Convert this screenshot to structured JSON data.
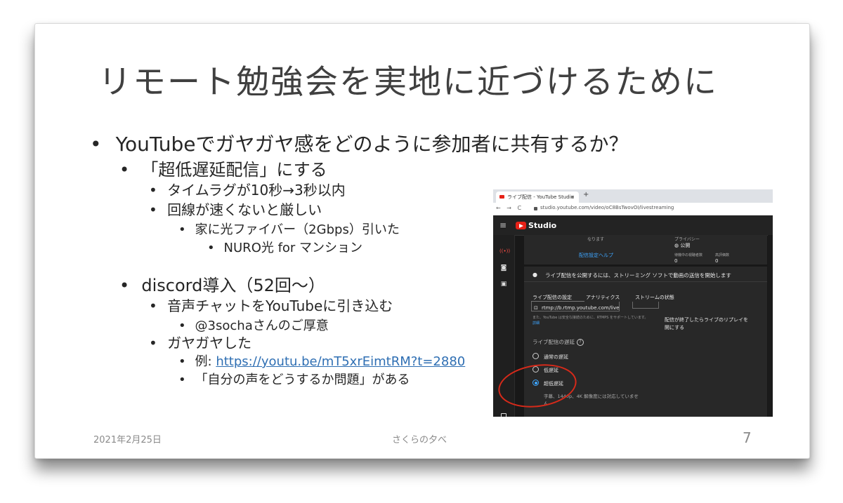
{
  "slide": {
    "title": "リモート勉強会を実地に近づけるために",
    "bullets": {
      "b1": "YouTubeでガヤガヤ感をどのように参加者に共有するか？",
      "b1_1": "「超低遅延配信」にする",
      "b1_1_1": "タイムラグが10秒→3秒以内",
      "b1_1_2": "回線が速くないと厳しい",
      "b1_1_2_1": "家に光ファイバー（2Gbps）引いた",
      "b1_1_2_1_1": "NURO光 for マンション",
      "b2": "discord導入（52回〜）",
      "b2_1": "音声チャットをYouTubeに引き込む",
      "b2_1_1": "@3sochaさんのご厚意",
      "b2_2": "ガヤガヤした",
      "b2_2_1_prefix": "例: ",
      "b2_2_1_link": "https://youtu.be/mT5xrEimtRM?t=2880",
      "b2_2_2": "「自分の声をどうするか問題」がある"
    },
    "bullet_char": "•",
    "footer": {
      "date": "2021年2月25日",
      "center": "さくらの夕べ",
      "page": "7"
    },
    "colors": {
      "title": "#404040",
      "link": "#2f6fb3",
      "annotation": "#d62a1a"
    }
  },
  "screenshot": {
    "browser": {
      "tab_title": "ライブ配信 - YouTube Studio",
      "tab_close": "×",
      "new_tab": "+",
      "nav": "← → C",
      "url": "studio.youtube.com/video/oC8BsTwovOI/livestreaming"
    },
    "header": {
      "menu_icon": "≡",
      "brand": "Studio"
    },
    "sidebar_icons": [
      "live-icon",
      "camera-icon",
      "calendar-icon",
      "square-icon"
    ],
    "top_panel": {
      "cut_text": "なります",
      "help_link": "配信設定ヘルプ",
      "privacy_label": "プライバシー",
      "privacy_value": "公開",
      "viewers_label": "待機中の視聴者数",
      "viewers_value": "0",
      "likes_label": "高評価数",
      "likes_value": "0"
    },
    "notice": "ライブ配信を公開するには、ストリーミング ソフトで動画の送信を開始します",
    "tabs": [
      "ライブ配信の設定",
      "アナリティクス",
      "ストリームの状態"
    ],
    "stream_url": "rtmp://b.rtmp.youtube.com/live",
    "note_text": "また、YouTube は安全な接続のために、RTMPS をサポートしています。",
    "note_link": "詳細",
    "replay_text_1": "配信が終了したらライブのリプレイを",
    "replay_text_2": "開にする",
    "latency_label": "ライブ配信の遅延",
    "latency_help": "?",
    "latency_options": [
      {
        "label": "通常の遅延",
        "selected": false
      },
      {
        "label": "低遅延",
        "selected": false
      },
      {
        "label": "超低遅延",
        "selected": true
      }
    ],
    "latency_note": "字幕、1440p、4K 解像度には対応していませ",
    "latency_note_2": "ん"
  }
}
